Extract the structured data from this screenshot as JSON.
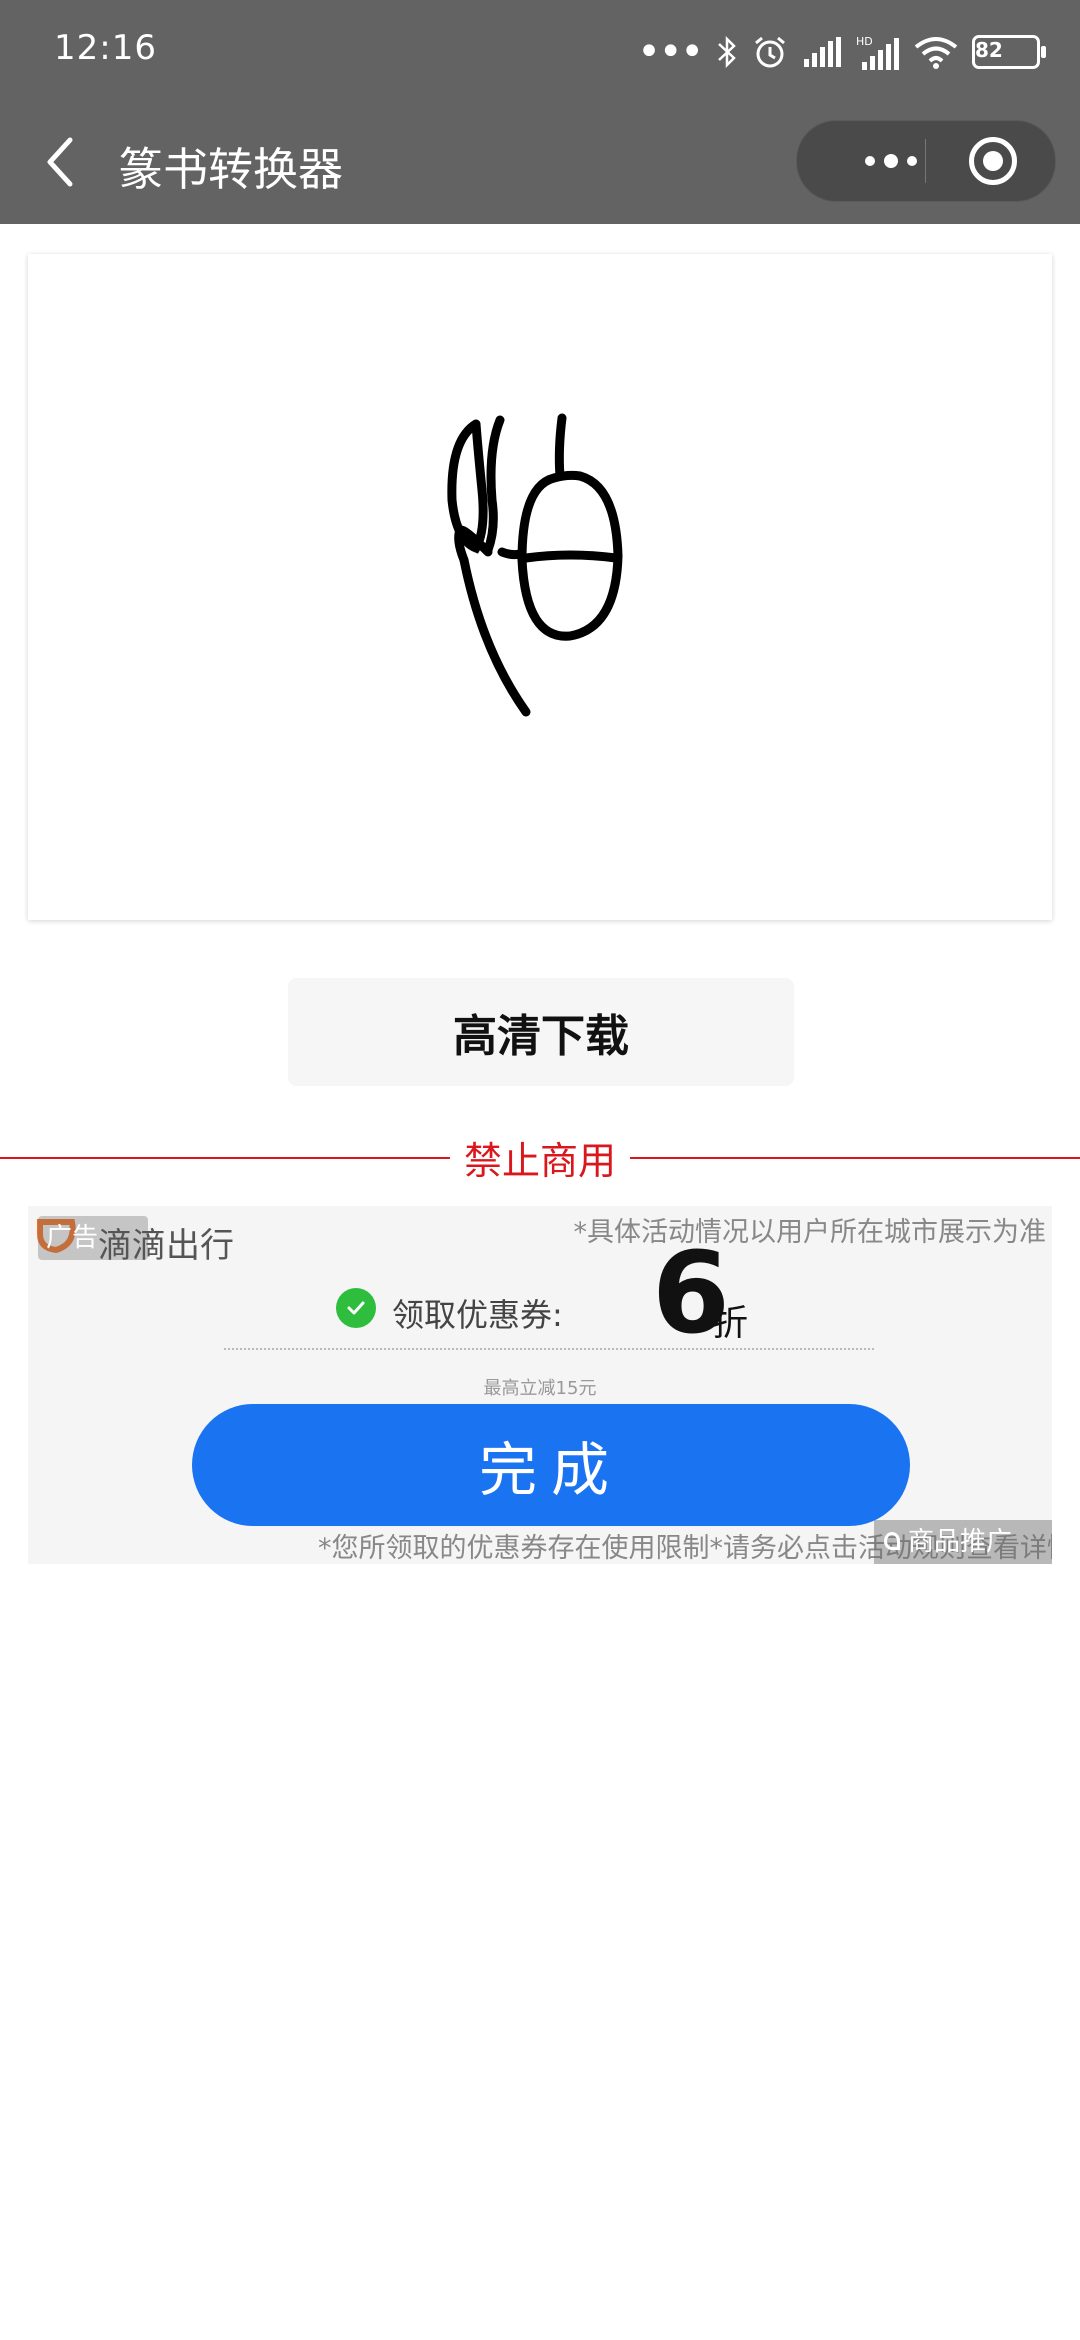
{
  "status_bar": {
    "time": "12:16",
    "battery": "82",
    "icons": [
      "more-dots-icon",
      "bluetooth-icon",
      "alarm-icon",
      "signal-icon",
      "hd-signal-icon",
      "wifi-icon",
      "battery-icon"
    ]
  },
  "header": {
    "title": "篆书转换器",
    "bg_color": "#636363"
  },
  "download": {
    "label": "高清下载"
  },
  "warning": {
    "text": "禁止商用",
    "color": "#d9171c"
  },
  "ad": {
    "badge": "广告",
    "brand": "滴滴出行",
    "note_top": "*具体活动情况以用户所在城市展示为准",
    "coupon_label": "领取优惠券:",
    "discount_value": "6",
    "discount_unit": "折",
    "max_text": "最高立减15元",
    "done_label": "完成",
    "note_bottom": "*您所领取的优惠券存在使用限制*请务必点击活动规则查看详情",
    "promo_badge": "商品推广",
    "button_color": "#1a73f1"
  }
}
